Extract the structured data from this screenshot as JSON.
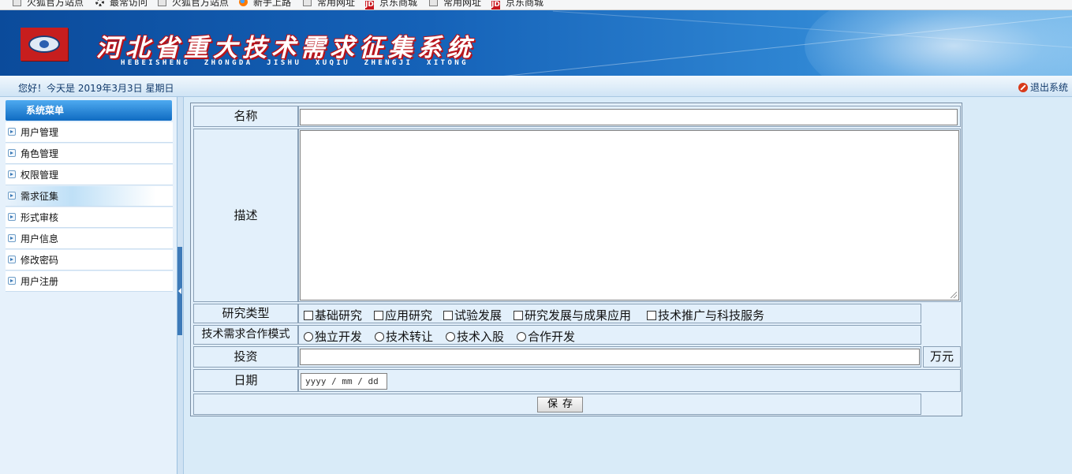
{
  "bookmarks": [
    {
      "label": "火狐官方站点",
      "icon": "folder-icon"
    },
    {
      "label": "最常访问",
      "icon": "gear-icon"
    },
    {
      "label": "火狐官方站点",
      "icon": "folder-icon"
    },
    {
      "label": "新手上路",
      "icon": "firefox-icon"
    },
    {
      "label": "常用网址",
      "icon": "folder-icon"
    },
    {
      "label": "京东商城",
      "icon": "jd-icon"
    },
    {
      "label": "常用网址",
      "icon": "folder-icon"
    },
    {
      "label": "京东商城",
      "icon": "jd-icon"
    }
  ],
  "banner": {
    "title": "河北省重大技术需求征集系统",
    "pinyin": "HEBEISHENG  ZHONGDA  JISHU  XUQIU  ZHENGJI  XITONG"
  },
  "status": {
    "greeting": "您好！今天是 2019年3月3日 星期日",
    "logout": "退出系统"
  },
  "sidebar": {
    "header": "系统菜单",
    "items": [
      {
        "label": "用户管理"
      },
      {
        "label": "角色管理"
      },
      {
        "label": "权限管理"
      },
      {
        "label": "需求征集",
        "active": true
      },
      {
        "label": "形式审核"
      },
      {
        "label": "用户信息"
      },
      {
        "label": "修改密码"
      },
      {
        "label": "用户注册"
      }
    ]
  },
  "form": {
    "name_label": "名称",
    "name_value": "",
    "desc_label": "描述",
    "desc_value": "",
    "research_type_label": "研究类型",
    "research_types": [
      "基础研究",
      "应用研究",
      "试验发展",
      "研究发展与成果应用",
      "技术推广与科技服务"
    ],
    "coop_mode_label": "技术需求合作模式",
    "coop_modes": [
      "独立开发",
      "技术转让",
      "技术入股",
      "合作开发"
    ],
    "investment_label": "投资",
    "investment_value": "",
    "investment_unit": "万元",
    "date_label": "日期",
    "date_placeholder": "yyyy / mm / dd",
    "save_label": "保存"
  },
  "colors": {
    "banner_blue": "#1562b8",
    "title_red": "#b8131a",
    "menu_header": "#0f6bc2",
    "page_bg": "#d9ebf8"
  }
}
